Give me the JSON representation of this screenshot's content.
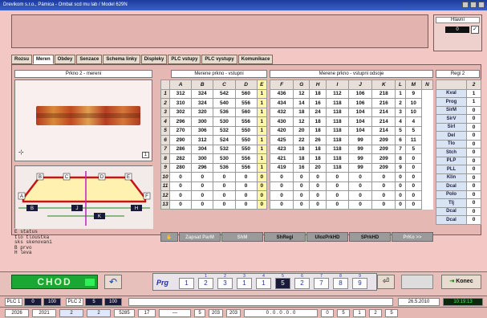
{
  "window": {
    "title": "Drevikom s.r.o., Pámica - Ombat scd mu lab / Model 629N"
  },
  "state": {
    "label": "Hlavní",
    "value": "0",
    "check": "✓"
  },
  "tabs": [
    "Rozsu",
    "Meren",
    "Obdey",
    "Senzace",
    "Schema linky",
    "Displeky",
    "PLC vstupy",
    "PLC vystupy",
    "Komunikace"
  ],
  "panels": {
    "left": "Prkno 2 - mereni",
    "entry": "Merene prkno - vstupni",
    "exit": "Merene prkno - vstupni odsoje",
    "right": "Regi 2"
  },
  "photo": {
    "index": "1"
  },
  "diagram": {
    "labels": [
      "A",
      "B",
      "C",
      "D",
      "E",
      "F"
    ],
    "dims": [
      "B",
      "J",
      "K",
      "H"
    ]
  },
  "legend": [
    "E    status",
    "tlo  tloustka",
    "sks  skenovani",
    "B    prvo",
    "H    leva"
  ],
  "entry_table": {
    "headers": [
      "A",
      "B",
      "C",
      "D",
      "E"
    ],
    "rows": [
      [
        "1",
        "312",
        "324",
        "542",
        "560",
        "1"
      ],
      [
        "2",
        "310",
        "324",
        "540",
        "556",
        "1"
      ],
      [
        "3",
        "302",
        "320",
        "536",
        "560",
        "1"
      ],
      [
        "4",
        "296",
        "300",
        "530",
        "556",
        "1"
      ],
      [
        "5",
        "270",
        "306",
        "532",
        "550",
        "1"
      ],
      [
        "6",
        "290",
        "312",
        "524",
        "550",
        "1"
      ],
      [
        "7",
        "286",
        "304",
        "532",
        "550",
        "1"
      ],
      [
        "8",
        "282",
        "300",
        "530",
        "556",
        "1"
      ],
      [
        "9",
        "280",
        "296",
        "536",
        "556",
        "1"
      ],
      [
        "10",
        "0",
        "0",
        "0",
        "0",
        "0"
      ],
      [
        "11",
        "0",
        "0",
        "0",
        "0",
        "0"
      ],
      [
        "12",
        "0",
        "0",
        "0",
        "0",
        "0"
      ],
      [
        "13",
        "0",
        "0",
        "0",
        "0",
        "0"
      ]
    ]
  },
  "exit_table": {
    "headers": [
      "F",
      "G",
      "H",
      "I",
      "J",
      "K",
      "L",
      "M",
      "N"
    ],
    "rows": [
      [
        "436",
        "12",
        "18",
        "112",
        "106",
        "218",
        "1",
        "9"
      ],
      [
        "434",
        "14",
        "16",
        "118",
        "106",
        "216",
        "2",
        "10"
      ],
      [
        "432",
        "18",
        "24",
        "118",
        "104",
        "214",
        "3",
        "10"
      ],
      [
        "430",
        "12",
        "18",
        "118",
        "104",
        "214",
        "4",
        "4"
      ],
      [
        "420",
        "20",
        "18",
        "118",
        "104",
        "214",
        "5",
        "5"
      ],
      [
        "425",
        "22",
        "26",
        "118",
        "99",
        "209",
        "6",
        "11"
      ],
      [
        "423",
        "18",
        "18",
        "118",
        "99",
        "209",
        "7",
        "5"
      ],
      [
        "421",
        "18",
        "18",
        "118",
        "99",
        "209",
        "8",
        "0"
      ],
      [
        "419",
        "16",
        "20",
        "118",
        "99",
        "209",
        "9",
        "0"
      ],
      [
        "0",
        "0",
        "0",
        "0",
        "0",
        "0",
        "0",
        "0"
      ],
      [
        "0",
        "0",
        "0",
        "0",
        "0",
        "0",
        "0",
        "0"
      ],
      [
        "0",
        "0",
        "0",
        "0",
        "0",
        "0",
        "0",
        "0"
      ],
      [
        "0",
        "0",
        "0",
        "0",
        "0",
        "0",
        "0",
        "0"
      ]
    ]
  },
  "reg_table": {
    "header": "2",
    "rows": [
      [
        "Kval",
        "1"
      ],
      [
        "Prog",
        "1"
      ],
      [
        "SirM",
        "0"
      ],
      [
        "SirV",
        "0"
      ],
      [
        "Sirl",
        "0"
      ],
      [
        "Del",
        "0"
      ],
      [
        "Tlo",
        "0"
      ],
      [
        "Stch",
        "0"
      ],
      [
        "PLP",
        "0"
      ],
      [
        "PLL",
        "0"
      ],
      [
        "Klin",
        "0"
      ],
      [
        "Dcal",
        "0"
      ],
      [
        "Polo",
        "0"
      ],
      [
        "Tlj",
        "0"
      ],
      [
        "Dcal",
        "0"
      ],
      [
        "Dcal",
        "0"
      ]
    ]
  },
  "buttons": [
    "Zapsat ParM",
    "ShM",
    "ShRegi",
    "UlozPrkHD",
    "SPrkHD",
    "PrKo >>"
  ],
  "chod": "CHOD",
  "prog": {
    "label": "Prg",
    "numbers": [
      "1",
      "2",
      "3",
      "4",
      "5",
      "6",
      "7",
      "8",
      "9"
    ],
    "values": [
      "1",
      "2",
      "3",
      "1",
      "1",
      "5",
      "2",
      "7",
      "8",
      "9"
    ],
    "current_index": 5
  },
  "konec": "Konec",
  "status1": {
    "plc1": "PLC 1",
    "plc1_a": "0",
    "plc1_b": "100",
    "plc2": "PLC 2",
    "plc2_a": "5",
    "plc2_b": "100",
    "date": "26.5.2010",
    "time": "10:19:13"
  },
  "status2": [
    "2026",
    "2021",
    "2",
    "2",
    "5285",
    "17",
    "—",
    "5",
    "203",
    "203",
    "0 . 0 . 0 . 0 . 0",
    "0",
    "5",
    "1",
    "2",
    "5"
  ],
  "colors": {
    "accent": "#1c3ea8",
    "chod": "#1aa832",
    "background": "#f3c8c4"
  }
}
